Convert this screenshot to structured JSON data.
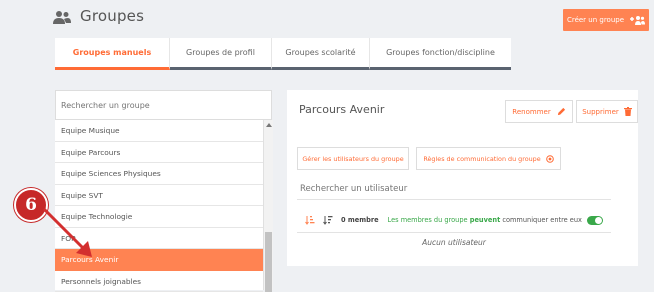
{
  "header": {
    "title": "Groupes",
    "create_button": "Créer un groupe",
    "icon": "users-icon",
    "create_icon": "add-users-icon"
  },
  "tabs": [
    {
      "label": "Groupes manuels",
      "active": true
    },
    {
      "label": "Groupes de profil",
      "active": false
    },
    {
      "label": "Groupes scolarité",
      "active": false
    },
    {
      "label": "Groupes fonction/discipline",
      "active": false
    }
  ],
  "group_search": {
    "placeholder": "Rechercher un groupe"
  },
  "groups": [
    {
      "label": "Equipe Musique"
    },
    {
      "label": "Equipe Parcours"
    },
    {
      "label": "Equipe Sciences Physiques"
    },
    {
      "label": "Equipe SVT"
    },
    {
      "label": "Equipe Technologie"
    },
    {
      "label": "FOR"
    },
    {
      "label": "Parcours Avenir",
      "selected": true
    },
    {
      "label": "Personnels joignables"
    }
  ],
  "detail": {
    "title": "Parcours Avenir",
    "rename_label": "Renommer",
    "delete_label": "Supprimer",
    "manage_users_label": "Gérer les utilisateurs du groupe",
    "comm_rules_label": "Règles de communication du groupe",
    "user_search_placeholder": "Rechercher un utilisateur",
    "member_count": "0 membre",
    "comm_text_1": "Les membres du groupe",
    "comm_text_bold": "peuvent",
    "comm_text_2": "communiquer entre eux",
    "comm_enabled": true,
    "no_user": "Aucun utilisateur"
  },
  "annotation": {
    "step": "6"
  },
  "colors": {
    "accent": "#ff6b35",
    "button": "#ff8352",
    "badge": "#c62828",
    "toggle": "#3aa84a"
  }
}
